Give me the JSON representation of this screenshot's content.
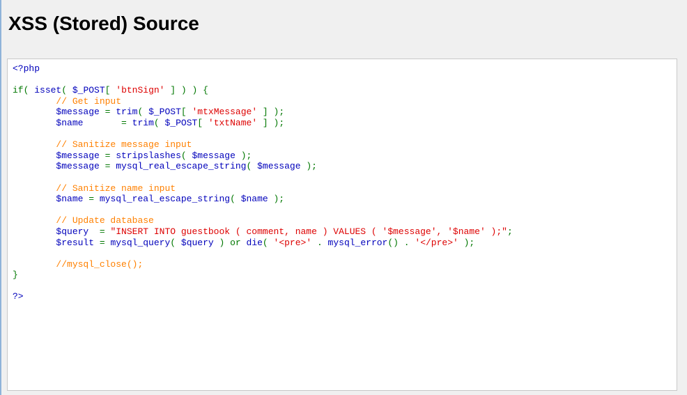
{
  "page": {
    "title": "XSS (Stored) Source"
  },
  "colors": {
    "default": "#0000bb",
    "keyword": "#007700",
    "string": "#dd0000",
    "comment": "#ff8000"
  },
  "code_lines": [
    [
      {
        "c": "var",
        "t": "<?php"
      }
    ],
    [],
    [
      {
        "c": "kw",
        "t": "if( "
      },
      {
        "c": "var",
        "t": "isset"
      },
      {
        "c": "kw",
        "t": "( "
      },
      {
        "c": "var",
        "t": "$_POST"
      },
      {
        "c": "kw",
        "t": "[ "
      },
      {
        "c": "str",
        "t": "'btnSign'"
      },
      {
        "c": "kw",
        "t": " ] ) ) {"
      }
    ],
    [
      {
        "c": "kw",
        "t": "        "
      },
      {
        "c": "cmt",
        "t": "// Get input"
      }
    ],
    [
      {
        "c": "kw",
        "t": "        "
      },
      {
        "c": "var",
        "t": "$message "
      },
      {
        "c": "kw",
        "t": "= "
      },
      {
        "c": "var",
        "t": "trim"
      },
      {
        "c": "kw",
        "t": "( "
      },
      {
        "c": "var",
        "t": "$_POST"
      },
      {
        "c": "kw",
        "t": "[ "
      },
      {
        "c": "str",
        "t": "'mtxMessage'"
      },
      {
        "c": "kw",
        "t": " ] );"
      }
    ],
    [
      {
        "c": "kw",
        "t": "        "
      },
      {
        "c": "var",
        "t": "$name       "
      },
      {
        "c": "kw",
        "t": "= "
      },
      {
        "c": "var",
        "t": "trim"
      },
      {
        "c": "kw",
        "t": "( "
      },
      {
        "c": "var",
        "t": "$_POST"
      },
      {
        "c": "kw",
        "t": "[ "
      },
      {
        "c": "str",
        "t": "'txtName'"
      },
      {
        "c": "kw",
        "t": " ] );"
      }
    ],
    [],
    [
      {
        "c": "kw",
        "t": "        "
      },
      {
        "c": "cmt",
        "t": "// Sanitize message input"
      }
    ],
    [
      {
        "c": "kw",
        "t": "        "
      },
      {
        "c": "var",
        "t": "$message "
      },
      {
        "c": "kw",
        "t": "= "
      },
      {
        "c": "var",
        "t": "stripslashes"
      },
      {
        "c": "kw",
        "t": "( "
      },
      {
        "c": "var",
        "t": "$message "
      },
      {
        "c": "kw",
        "t": ");"
      }
    ],
    [
      {
        "c": "kw",
        "t": "        "
      },
      {
        "c": "var",
        "t": "$message "
      },
      {
        "c": "kw",
        "t": "= "
      },
      {
        "c": "var",
        "t": "mysql_real_escape_string"
      },
      {
        "c": "kw",
        "t": "( "
      },
      {
        "c": "var",
        "t": "$message "
      },
      {
        "c": "kw",
        "t": ");"
      }
    ],
    [],
    [
      {
        "c": "kw",
        "t": "        "
      },
      {
        "c": "cmt",
        "t": "// Sanitize name input"
      }
    ],
    [
      {
        "c": "kw",
        "t": "        "
      },
      {
        "c": "var",
        "t": "$name "
      },
      {
        "c": "kw",
        "t": "= "
      },
      {
        "c": "var",
        "t": "mysql_real_escape_string"
      },
      {
        "c": "kw",
        "t": "( "
      },
      {
        "c": "var",
        "t": "$name "
      },
      {
        "c": "kw",
        "t": ");"
      }
    ],
    [],
    [
      {
        "c": "kw",
        "t": "        "
      },
      {
        "c": "cmt",
        "t": "// Update database"
      }
    ],
    [
      {
        "c": "kw",
        "t": "        "
      },
      {
        "c": "var",
        "t": "$query  "
      },
      {
        "c": "kw",
        "t": "= "
      },
      {
        "c": "str",
        "t": "\"INSERT INTO guestbook ( comment, name ) VALUES ( '$message', '$name' );\""
      },
      {
        "c": "kw",
        "t": ";"
      }
    ],
    [
      {
        "c": "kw",
        "t": "        "
      },
      {
        "c": "var",
        "t": "$result "
      },
      {
        "c": "kw",
        "t": "= "
      },
      {
        "c": "var",
        "t": "mysql_query"
      },
      {
        "c": "kw",
        "t": "( "
      },
      {
        "c": "var",
        "t": "$query "
      },
      {
        "c": "kw",
        "t": ") or "
      },
      {
        "c": "var",
        "t": "die"
      },
      {
        "c": "kw",
        "t": "( "
      },
      {
        "c": "str",
        "t": "'<pre>'"
      },
      {
        "c": "kw",
        "t": " . "
      },
      {
        "c": "var",
        "t": "mysql_error"
      },
      {
        "c": "kw",
        "t": "() . "
      },
      {
        "c": "str",
        "t": "'</pre>'"
      },
      {
        "c": "kw",
        "t": " );"
      }
    ],
    [],
    [
      {
        "c": "kw",
        "t": "        "
      },
      {
        "c": "cmt",
        "t": "//mysql_close();"
      }
    ],
    [
      {
        "c": "kw",
        "t": "}"
      }
    ],
    [],
    [
      {
        "c": "var",
        "t": "?>"
      }
    ]
  ]
}
